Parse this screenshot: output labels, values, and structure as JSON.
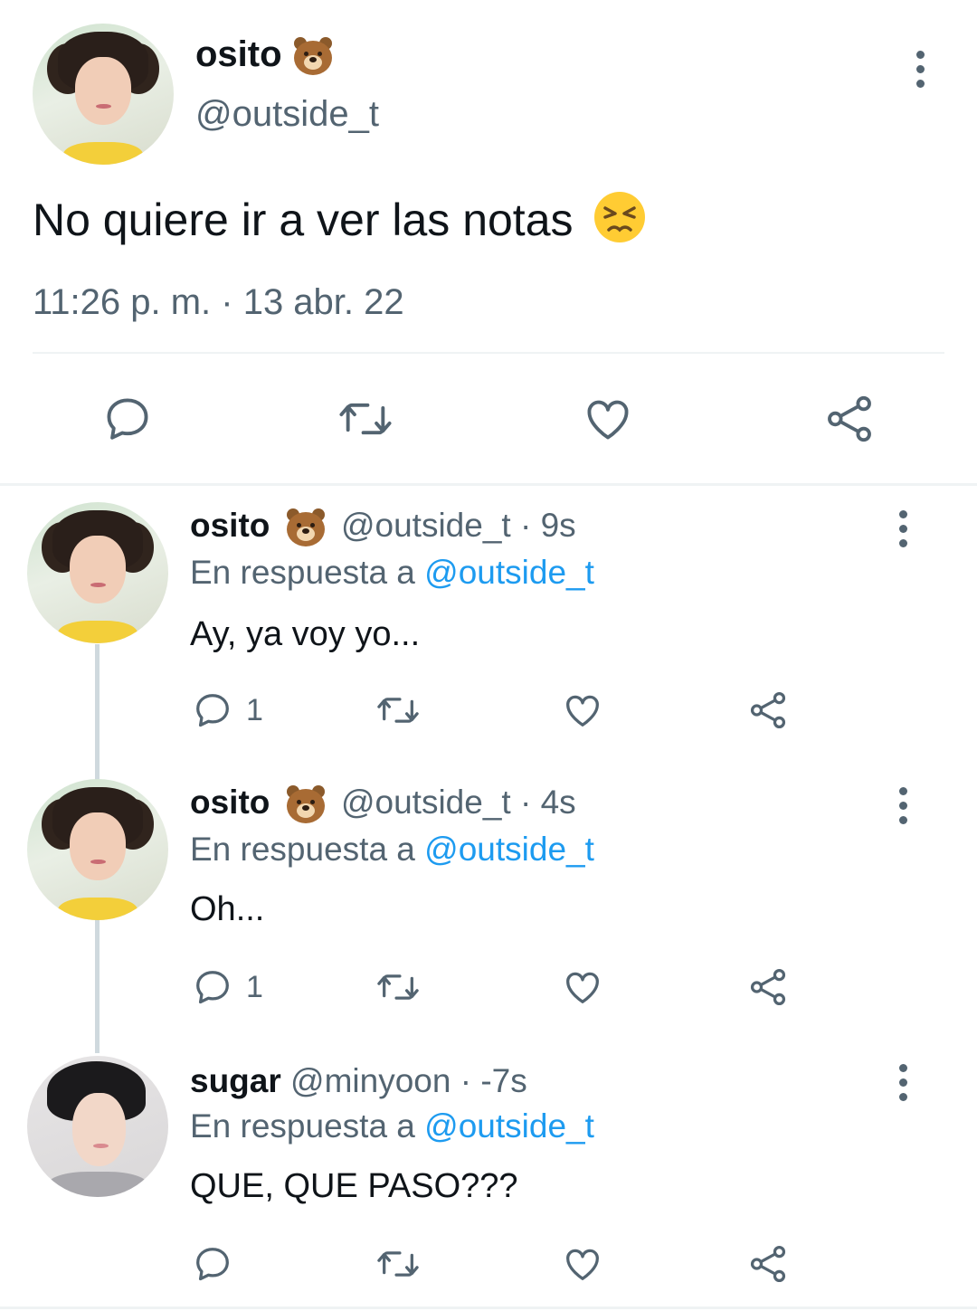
{
  "main_tweet": {
    "display_name": "osito",
    "handle": "@outside_t",
    "text": "No quiere ir a ver las notas",
    "text_emoji": "persevering-face-emoji",
    "timestamp": "11:26 p. m. · 13 abr. 22"
  },
  "replies": [
    {
      "display_name": "osito",
      "handle": "@outside_t",
      "time": "· 9s",
      "reply_prefix": "En respuesta a",
      "reply_to": "@outside_t",
      "text": "Ay, ya voy yo...",
      "reply_count": "1"
    },
    {
      "display_name": "osito",
      "handle": "@outside_t",
      "time": "· 4s",
      "reply_prefix": "En respuesta a",
      "reply_to": "@outside_t",
      "text": "Oh...",
      "reply_count": "1"
    },
    {
      "display_name": "sugar",
      "handle": "@minyoon",
      "time": "· -7s",
      "reply_prefix": "En respuesta a",
      "reply_to": "@outside_t",
      "text": "QUE, QUE PASO???",
      "reply_count": ""
    }
  ],
  "colors": {
    "text": "#0f1419",
    "secondary": "#536471",
    "link": "#1d9bf0",
    "divider": "#eff3f4"
  },
  "icons": [
    "reply-icon",
    "retweet-icon",
    "like-icon",
    "share-icon",
    "more-icon",
    "bear-emoji"
  ]
}
